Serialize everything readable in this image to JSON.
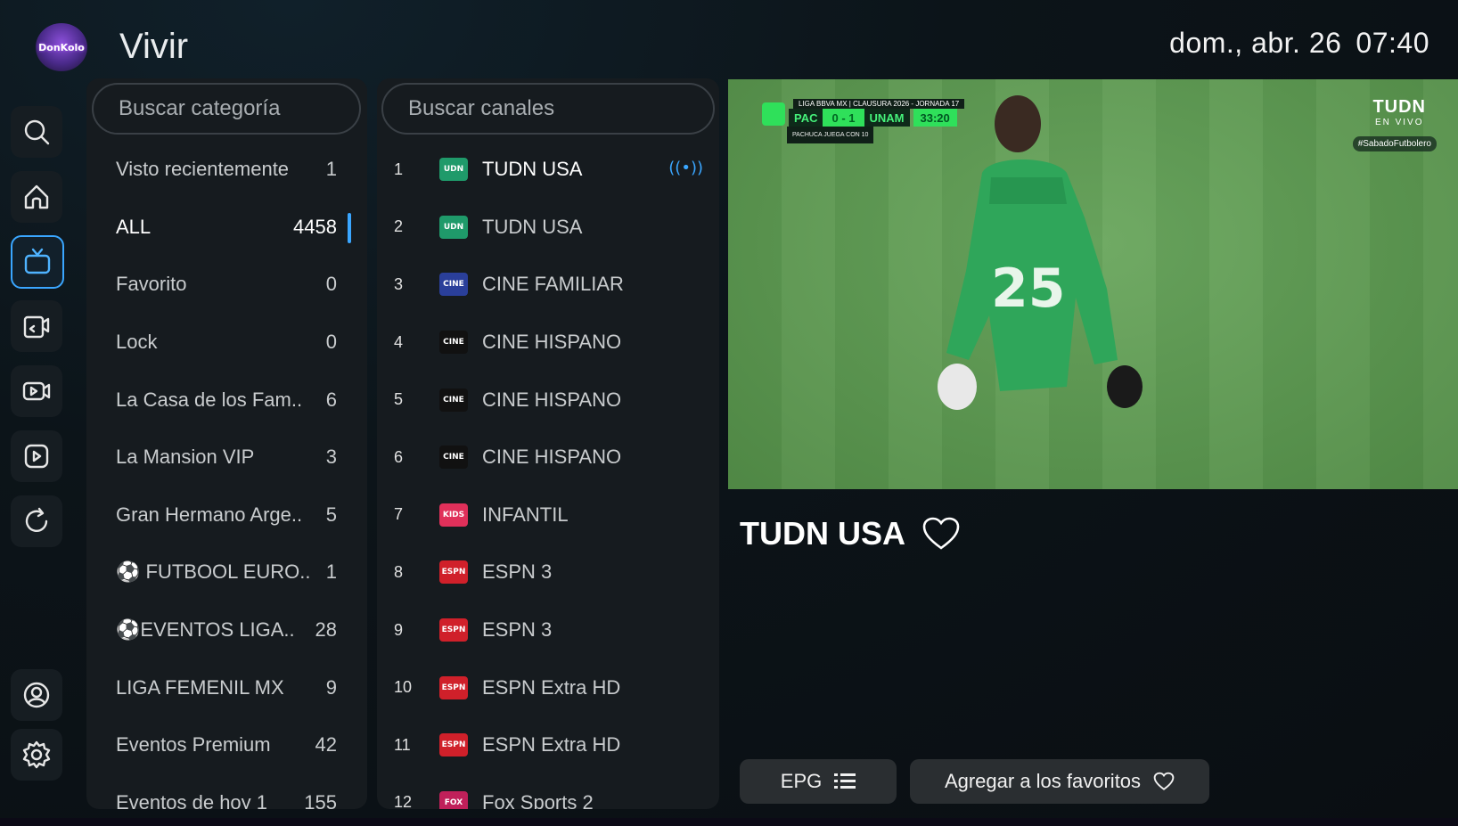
{
  "app": {
    "logo_text": "DonKolo",
    "page_title": "Vivir"
  },
  "clock": {
    "date": "dom., abr. 26",
    "time": "07:40"
  },
  "nav": [
    {
      "icon": "search-icon"
    },
    {
      "icon": "home-icon"
    },
    {
      "icon": "live-tv-icon",
      "active": true
    },
    {
      "icon": "movies-icon"
    },
    {
      "icon": "series-icon"
    },
    {
      "icon": "play-icon"
    },
    {
      "icon": "refresh-icon"
    },
    {
      "icon": "account-icon"
    },
    {
      "icon": "settings-icon"
    }
  ],
  "categories": {
    "search_placeholder": "Buscar categoría",
    "items": [
      {
        "name": "Visto recientemente",
        "count": "1"
      },
      {
        "name": "ALL",
        "count": "4458",
        "active": true
      },
      {
        "name": "Favorito",
        "count": "0"
      },
      {
        "name": "Lock",
        "count": "0"
      },
      {
        "name": "La Casa de los Fam..",
        "count": "6"
      },
      {
        "name": "La Mansion VIP",
        "count": "3"
      },
      {
        "name": "Gran Hermano Arge..",
        "count": "5"
      },
      {
        "name": "⚽ FUTBOOL EURO..",
        "count": "1"
      },
      {
        "name": "⚽EVENTOS LIGA..",
        "count": "28"
      },
      {
        "name": "LIGA FEMENIL MX",
        "count": "9"
      },
      {
        "name": "Eventos Premium",
        "count": "42"
      },
      {
        "name": "Eventos de hoy 1",
        "count": "155"
      }
    ]
  },
  "channels": {
    "search_placeholder": "Buscar canales",
    "items": [
      {
        "num": "1",
        "name": "TUDN USA",
        "logo": "UDN",
        "logo_color": "#1f9a6a",
        "active": true
      },
      {
        "num": "2",
        "name": "TUDN USA",
        "logo": "UDN",
        "logo_color": "#1f9a6a"
      },
      {
        "num": "3",
        "name": "CINE FAMILIAR",
        "logo": "CINE",
        "logo_color": "#2a3f9a"
      },
      {
        "num": "4",
        "name": "CINE HISPANO",
        "logo": "CINE",
        "logo_color": "#111111"
      },
      {
        "num": "5",
        "name": "CINE HISPANO",
        "logo": "CINE",
        "logo_color": "#111111"
      },
      {
        "num": "6",
        "name": "CINE HISPANO",
        "logo": "CINE",
        "logo_color": "#111111"
      },
      {
        "num": "7",
        "name": "INFANTIL",
        "logo": "KIDS",
        "logo_color": "#e0305a"
      },
      {
        "num": "8",
        "name": "ESPN 3",
        "logo": "ESPN",
        "logo_color": "#d0202a"
      },
      {
        "num": "9",
        "name": "ESPN 3",
        "logo": "ESPN",
        "logo_color": "#d0202a"
      },
      {
        "num": "10",
        "name": "ESPN Extra HD",
        "logo": "ESPN",
        "logo_color": "#d0202a"
      },
      {
        "num": "11",
        "name": "ESPN Extra HD",
        "logo": "ESPN",
        "logo_color": "#d0202a"
      },
      {
        "num": "12",
        "name": "Fox Sports 2",
        "logo": "FOX",
        "logo_color": "#c0205a"
      }
    ]
  },
  "player": {
    "scorebug": {
      "header": "LIGA BBVA MX | CLAUSURA 2026 - JORNADA 17",
      "home": "PAC",
      "score": "0 - 1",
      "away": "UNAM",
      "time": "33:20",
      "sub": "PACHUCA JUEGA CON 10"
    },
    "brand_line1": "TUDN",
    "brand_line2": "EN VIVO",
    "hashtag": "#SabadoFutbolero",
    "jersey_number": "25"
  },
  "current": {
    "title": "TUDN USA"
  },
  "buttons": {
    "epg": "EPG",
    "favorites": "Agregar a los favoritos"
  },
  "colors": {
    "accent": "#3aa6ff",
    "panel": "#161b1f",
    "background": "#0c1419"
  }
}
